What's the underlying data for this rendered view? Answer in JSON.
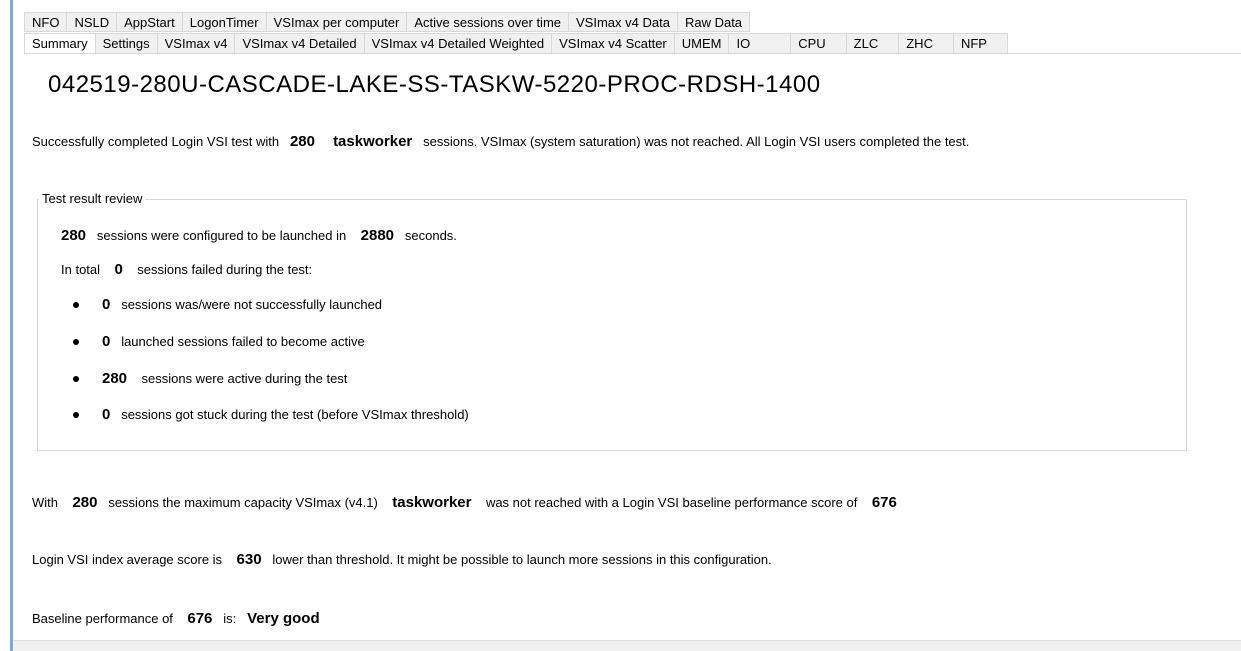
{
  "tabs_row1": [
    "NFO",
    "NSLD",
    "AppStart",
    "LogonTimer",
    "VSImax per computer",
    "Active sessions over time",
    "VSImax v4 Data",
    "Raw Data"
  ],
  "tabs_row2": [
    "Summary",
    "Settings",
    "VSImax v4",
    "VSImax v4 Detailed",
    "VSImax v4 Detailed Weighted",
    "VSImax v4 Scatter",
    "UMEM",
    "IO",
    "CPU",
    "ZLC",
    "ZHC",
    "NFP"
  ],
  "active_tab": "Summary",
  "title": "042519-280U-CASCADE-LAKE-SS-TASKW-5220-PROC-RDSH-1400",
  "summary_line": {
    "pre": "Successfully completed Login VSI test with",
    "sessions": "280",
    "workload": "taskworker",
    "post": "sessions. VSImax (system saturation) was not reached. All Login VSI users completed the test."
  },
  "review": {
    "legend": "Test result review",
    "configured": {
      "sessions": "280",
      "mid": "sessions were configured to be launched in",
      "seconds": "2880",
      "post": "seconds."
    },
    "failed": {
      "pre": "In total",
      "count": "0",
      "post": "sessions failed during the test:"
    },
    "bullets": [
      {
        "value": "0",
        "text": "sessions was/were not successfully launched"
      },
      {
        "value": "0",
        "text": "launched sessions failed to become active"
      },
      {
        "value": "280",
        "text": "sessions were active during the test"
      },
      {
        "value": "0",
        "text": "sessions got stuck during the test (before VSImax threshold)"
      }
    ]
  },
  "capacity_line": {
    "pre": "With",
    "sessions": "280",
    "mid": "sessions the maximum capacity VSImax (v4.1)",
    "workload": "taskworker",
    "mid2": "was not reached with a Login VSI baseline performance score of",
    "score": "676"
  },
  "index_line": {
    "pre": "Login VSI index average score is",
    "score": "630",
    "post": "lower than threshold. It might be possible to launch more sessions in this configuration."
  },
  "baseline_line": {
    "pre": "Baseline performance of",
    "score": "676",
    "mid": "is:",
    "rating": "Very good"
  }
}
